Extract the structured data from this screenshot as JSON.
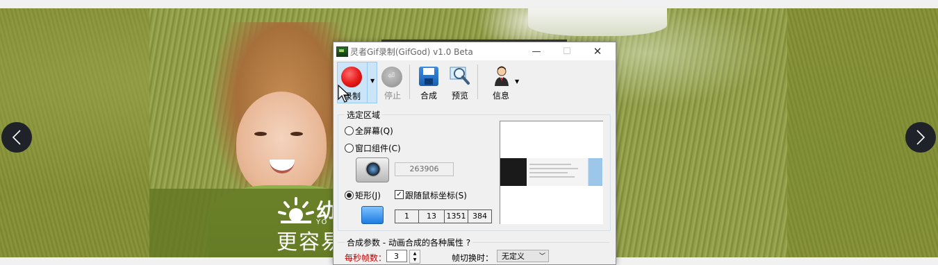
{
  "window": {
    "title": "灵者Gif录制(GifGod) v1.0 Beta",
    "minimize": "—",
    "maximize": "☐",
    "close": "✕"
  },
  "toolbar": {
    "record": "录制",
    "stop": "停止",
    "save": "合成",
    "preview": "预览",
    "info": "信息",
    "dropdown_glyph": "▼"
  },
  "area_group": {
    "title": "选定区域",
    "fullscreen": "全屏幕(Q)",
    "window_component": "窗口组件(C)",
    "window_handle": "263906",
    "rectangle": "矩形(J)",
    "follow_mouse": "跟随鼠标坐标(S)",
    "follow_mouse_checked": true,
    "selected_mode": "rectangle",
    "coords": [
      "1",
      "13",
      "1351",
      "384"
    ]
  },
  "compose_group": {
    "title": "合成参数 - 动画合成的各种属性  ?",
    "fps_label": "每秒帧数：",
    "fps_value": "3",
    "transition_label": "帧切换时：",
    "transition_value": "无定义"
  },
  "background": {
    "logo_text": "幼",
    "logo_sub": "YO",
    "slogan": "更容易",
    "prev_glyph": "‹",
    "next_glyph": "›"
  },
  "colors": {
    "accent_selected": "#cce4f7",
    "record_red": "#e81c1c",
    "fps_label_red": "#c00000",
    "background_green": "#808c36"
  }
}
